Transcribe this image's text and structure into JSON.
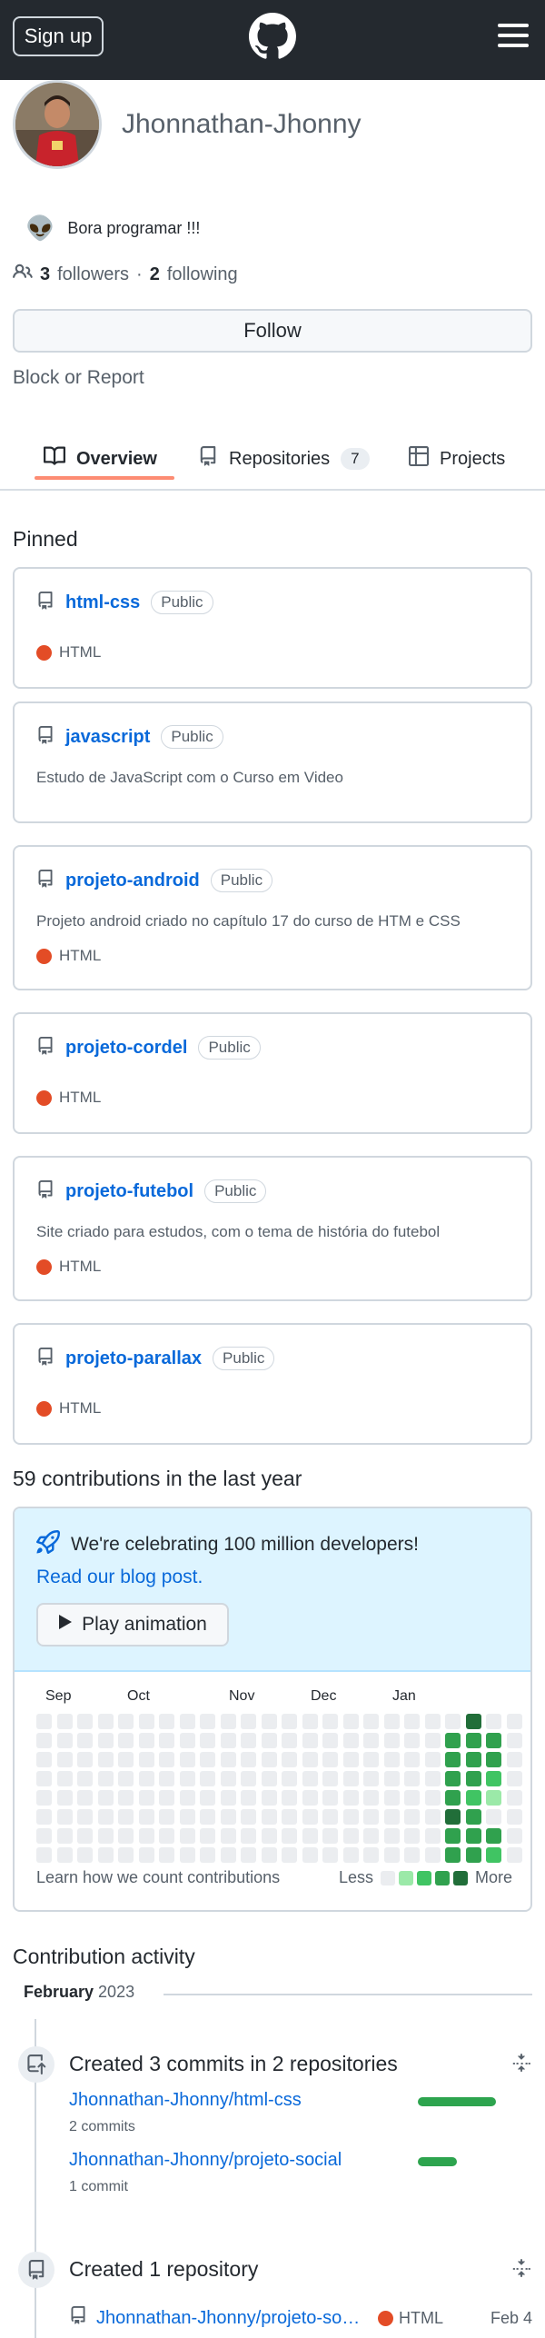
{
  "header": {
    "signup_label": "Sign up",
    "colors": {
      "bg": "#24292f"
    }
  },
  "profile": {
    "username": "Jhonnathan-Jhonny",
    "status_emoji": "👽",
    "status_text": "Bora programar !!!",
    "followers_count": "3",
    "followers_label": "followers",
    "separator": "·",
    "following_count": "2",
    "following_label": "following",
    "follow_label": "Follow",
    "block_report_label": "Block or Report"
  },
  "tabs": [
    {
      "label": "Overview",
      "icon": "book-icon",
      "active": true
    },
    {
      "label": "Repositories",
      "icon": "repo-icon",
      "count": "7"
    },
    {
      "label": "Projects",
      "icon": "table-icon"
    }
  ],
  "pinned": {
    "title": "Pinned",
    "repos": [
      {
        "name": "html-css",
        "visibility": "Public",
        "description": "",
        "language": "HTML"
      },
      {
        "name": "javascript",
        "visibility": "Public",
        "description": "Estudo de JavaScript com o Curso em Video",
        "language": ""
      },
      {
        "name": "projeto-android",
        "visibility": "Public",
        "description": "Projeto android criado no capítulo 17 do curso de HTM e CSS",
        "language": "HTML"
      },
      {
        "name": "projeto-cordel",
        "visibility": "Public",
        "description": "",
        "language": "HTML"
      },
      {
        "name": "projeto-futebol",
        "visibility": "Public",
        "description": "Site criado para estudos, com o tema de história do futebol",
        "language": "HTML"
      },
      {
        "name": "projeto-parallax",
        "visibility": "Public",
        "description": "",
        "language": "HTML"
      }
    ],
    "language_color": "#e34c26"
  },
  "contributions": {
    "title": "59 contributions in the last year",
    "banner_text": "We're celebrating 100 million developers!",
    "banner_link": "Read our blog post.",
    "play_label": "Play animation",
    "months": [
      "Sep",
      "Oct",
      "Nov",
      "Dec",
      "Jan"
    ],
    "learn_link": "Learn how we count contributions",
    "less_label": "Less",
    "more_label": "More",
    "level_colors": [
      "#ebedf0",
      "#9be9a8",
      "#40c463",
      "#30a14e",
      "#216e39"
    ],
    "active_weeks": [
      [
        0,
        3,
        3,
        3,
        3,
        4,
        3,
        3
      ],
      [
        4,
        3,
        3,
        3,
        2,
        3,
        3,
        3
      ],
      [
        0,
        3,
        3,
        2,
        1,
        0,
        3,
        2
      ]
    ]
  },
  "activity": {
    "title": "Contribution activity",
    "month": "February",
    "year": "2023",
    "items": [
      {
        "title": "Created 3 commits in 2 repositories",
        "icon": "repo-push-icon",
        "repos": [
          {
            "name": "Jhonnathan-Jhonny/html-css",
            "count": "2 commits",
            "bar_fraction": 1.0
          },
          {
            "name": "Jhonnathan-Jhonny/projeto-social",
            "count": "1 commit",
            "bar_fraction": 0.5
          }
        ]
      },
      {
        "title": "Created 1 repository",
        "icon": "repo-icon",
        "repo": "Jhonnathan-Jhonny/projeto-social",
        "language": "HTML",
        "date": "Feb 4"
      }
    ]
  }
}
